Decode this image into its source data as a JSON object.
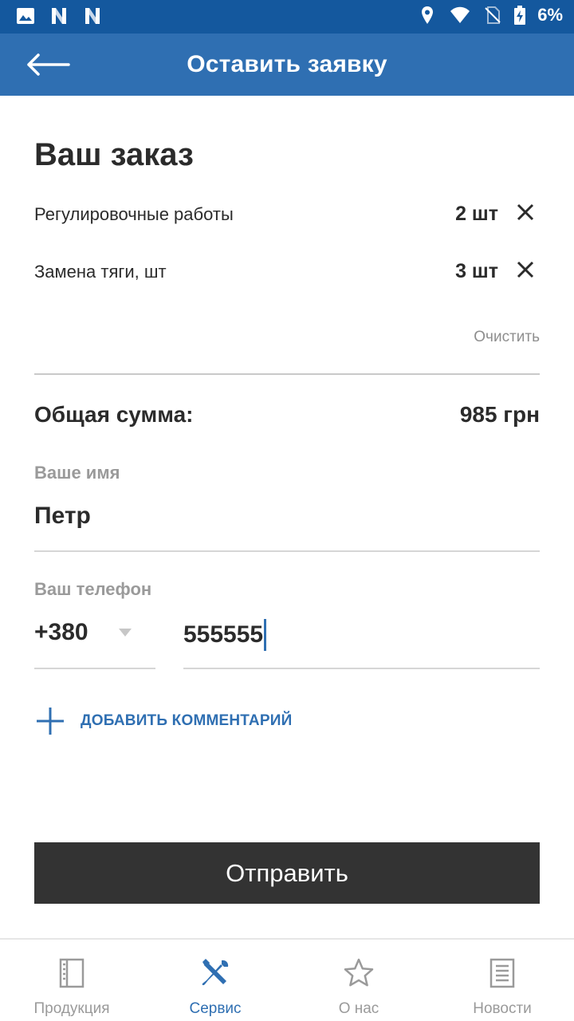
{
  "status_bar": {
    "battery_percent": "6%",
    "icons": [
      "image-icon",
      "n-notification-icon",
      "n-notification-icon",
      "location-icon",
      "wifi-icon",
      "no-sim-icon",
      "battery-charging-icon"
    ]
  },
  "app_bar": {
    "title": "Оставить заявку",
    "back_icon": "arrow-back-icon"
  },
  "order": {
    "title": "Ваш заказ",
    "items": [
      {
        "name": "Регулировочные работы",
        "qty": "2 шт"
      },
      {
        "name": "Замена тяги, шт",
        "qty": "3 шт"
      }
    ],
    "clear_label": "Очистить",
    "total_label": "Общая сумма:",
    "total_value": "985 грн"
  },
  "form": {
    "name_label": "Ваше имя",
    "name_value": "Петр",
    "phone_label": "Ваш телефон",
    "country_code": "+380",
    "phone_value": "555555",
    "add_comment_label": "ДОБАВИТЬ КОММЕНТАРИЙ",
    "submit_label": "Отправить"
  },
  "bottom_nav": {
    "items": [
      {
        "label": "Продукция",
        "icon": "book-icon",
        "active": false
      },
      {
        "label": "Сервис",
        "icon": "tools-icon",
        "active": true
      },
      {
        "label": "О нас",
        "icon": "star-icon",
        "active": false
      },
      {
        "label": "Новости",
        "icon": "document-icon",
        "active": false
      }
    ]
  },
  "colors": {
    "status_bar": "#14589e",
    "app_bar": "#2f6fb2",
    "accent": "#2f6fb2",
    "submit_button": "#333333",
    "muted_text": "#9a9a9a"
  }
}
